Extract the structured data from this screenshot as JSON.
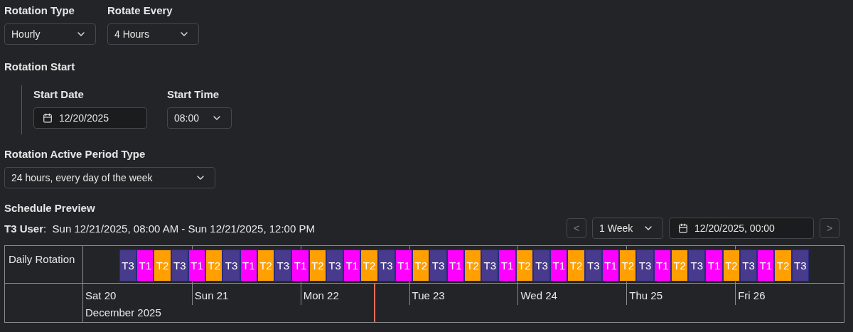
{
  "rotation_type": {
    "label": "Rotation Type",
    "value": "Hourly"
  },
  "rotate_every": {
    "label": "Rotate Every",
    "value": "4 Hours"
  },
  "rotation_start": {
    "label": "Rotation Start",
    "start_date": {
      "label": "Start Date",
      "value": "12/20/2025"
    },
    "start_time": {
      "label": "Start Time",
      "value": "08:00"
    }
  },
  "active_period": {
    "label": "Rotation Active Period Type",
    "value": "24 hours, every day of the week"
  },
  "schedule_preview": {
    "title": "Schedule Preview",
    "summary": "**T3 User**:  Sun 12/21/2025, 08:00 AM - Sun 12/21/2025, 12:00 PM",
    "prev_button": "<",
    "next_button": ">",
    "range_select": "1 Week",
    "date_field": "12/20/2025, 00:00",
    "row_label": "Daily Rotation",
    "shifts": [
      {
        "label": "T3",
        "color": "#483a8c"
      },
      {
        "label": "T1",
        "color": "#ff00ff"
      },
      {
        "label": "T2",
        "color": "#ffa000"
      },
      {
        "label": "T3",
        "color": "#483a8c"
      },
      {
        "label": "T1",
        "color": "#ff00ff"
      },
      {
        "label": "T2",
        "color": "#ffa000"
      },
      {
        "label": "T3",
        "color": "#483a8c"
      },
      {
        "label": "T1",
        "color": "#ff00ff"
      },
      {
        "label": "T2",
        "color": "#ffa000"
      },
      {
        "label": "T3",
        "color": "#483a8c"
      },
      {
        "label": "T1",
        "color": "#ff00ff"
      },
      {
        "label": "T2",
        "color": "#ffa000"
      },
      {
        "label": "T3",
        "color": "#483a8c"
      },
      {
        "label": "T1",
        "color": "#ff00ff"
      },
      {
        "label": "T2",
        "color": "#ffa000"
      },
      {
        "label": "T3",
        "color": "#483a8c"
      },
      {
        "label": "T1",
        "color": "#ff00ff"
      },
      {
        "label": "T2",
        "color": "#ffa000"
      },
      {
        "label": "T3",
        "color": "#483a8c"
      },
      {
        "label": "T1",
        "color": "#ff00ff"
      },
      {
        "label": "T2",
        "color": "#ffa000"
      },
      {
        "label": "T3",
        "color": "#483a8c"
      },
      {
        "label": "T1",
        "color": "#ff00ff"
      },
      {
        "label": "T2",
        "color": "#ffa000"
      },
      {
        "label": "T3",
        "color": "#483a8c"
      },
      {
        "label": "T1",
        "color": "#ff00ff"
      },
      {
        "label": "T2",
        "color": "#ffa000"
      },
      {
        "label": "T3",
        "color": "#483a8c"
      },
      {
        "label": "T1",
        "color": "#ff00ff"
      },
      {
        "label": "T2",
        "color": "#ffa000"
      },
      {
        "label": "T3",
        "color": "#483a8c"
      },
      {
        "label": "T1",
        "color": "#ff00ff"
      },
      {
        "label": "T2",
        "color": "#ffa000"
      },
      {
        "label": "T3",
        "color": "#483a8c"
      },
      {
        "label": "T1",
        "color": "#ff00ff"
      },
      {
        "label": "T2",
        "color": "#ffa000"
      },
      {
        "label": "T3",
        "color": "#483a8c"
      },
      {
        "label": "T1",
        "color": "#ff00ff"
      },
      {
        "label": "T2",
        "color": "#ffa000"
      },
      {
        "label": "T3",
        "color": "#483a8c"
      }
    ],
    "days": [
      "Sat 20",
      "Sun 21",
      "Mon 22",
      "Tue 23",
      "Wed 24",
      "Thu 25",
      "Fri 26"
    ],
    "month": "December 2025"
  }
}
